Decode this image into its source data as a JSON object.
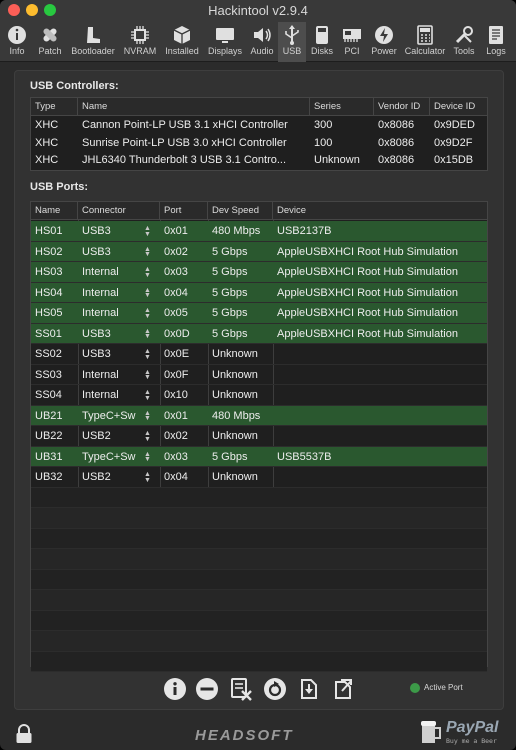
{
  "window": {
    "title": "Hackintool v2.9.4"
  },
  "toolbar": {
    "items": [
      {
        "label": "Info",
        "icon": "info-icon"
      },
      {
        "label": "Patch",
        "icon": "patch-icon"
      },
      {
        "label": "Bootloader",
        "icon": "boot-icon"
      },
      {
        "label": "NVRAM",
        "icon": "chip-icon"
      },
      {
        "label": "Installed",
        "icon": "package-icon"
      },
      {
        "label": "Displays",
        "icon": "display-icon"
      },
      {
        "label": "Audio",
        "icon": "speaker-icon"
      },
      {
        "label": "USB",
        "icon": "usb-icon"
      },
      {
        "label": "Disks",
        "icon": "disk-icon"
      },
      {
        "label": "PCI",
        "icon": "pci-icon"
      },
      {
        "label": "Power",
        "icon": "power-icon"
      },
      {
        "label": "Calculator",
        "icon": "calculator-icon"
      },
      {
        "label": "Tools",
        "icon": "tools-icon"
      },
      {
        "label": "Logs",
        "icon": "logs-icon"
      }
    ],
    "active": "USB"
  },
  "controllers": {
    "section_label": "USB Controllers:",
    "headers": {
      "type": "Type",
      "name": "Name",
      "series": "Series",
      "vendor": "Vendor ID",
      "device": "Device ID"
    },
    "rows": [
      {
        "type": "XHC",
        "name": "Cannon Point-LP USB 3.1 xHCI Controller",
        "series": "300",
        "vendor": "0x8086",
        "device": "0x9DED"
      },
      {
        "type": "XHC",
        "name": "Sunrise Point-LP USB 3.0 xHCI Controller",
        "series": "100",
        "vendor": "0x8086",
        "device": "0x9D2F"
      },
      {
        "type": "XHC",
        "name": "JHL6340 Thunderbolt 3 USB 3.1 Contro...",
        "series": "Unknown",
        "vendor": "0x8086",
        "device": "0x15DB"
      }
    ]
  },
  "ports": {
    "section_label": "USB Ports:",
    "headers": {
      "name": "Name",
      "connector": "Connector",
      "port": "Port",
      "speed": "Dev Speed",
      "device": "Device"
    },
    "rows": [
      {
        "name": "HS01",
        "connector": "USB3",
        "port": "0x01",
        "speed": "480 Mbps",
        "device": "USB2137B",
        "active": true
      },
      {
        "name": "HS02",
        "connector": "USB3",
        "port": "0x02",
        "speed": "5 Gbps",
        "device": "AppleUSBXHCI Root Hub Simulation",
        "active": true
      },
      {
        "name": "HS03",
        "connector": "Internal",
        "port": "0x03",
        "speed": "5 Gbps",
        "device": "AppleUSBXHCI Root Hub Simulation",
        "active": true
      },
      {
        "name": "HS04",
        "connector": "Internal",
        "port": "0x04",
        "speed": "5 Gbps",
        "device": "AppleUSBXHCI Root Hub Simulation",
        "active": true
      },
      {
        "name": "HS05",
        "connector": "Internal",
        "port": "0x05",
        "speed": "5 Gbps",
        "device": "AppleUSBXHCI Root Hub Simulation",
        "active": true
      },
      {
        "name": "SS01",
        "connector": "USB3",
        "port": "0x0D",
        "speed": "5 Gbps",
        "device": "AppleUSBXHCI Root Hub Simulation",
        "active": true
      },
      {
        "name": "SS02",
        "connector": "USB3",
        "port": "0x0E",
        "speed": "Unknown",
        "device": "",
        "active": false
      },
      {
        "name": "SS03",
        "connector": "Internal",
        "port": "0x0F",
        "speed": "Unknown",
        "device": "",
        "active": false
      },
      {
        "name": "SS04",
        "connector": "Internal",
        "port": "0x10",
        "speed": "Unknown",
        "device": "",
        "active": false
      },
      {
        "name": "UB21",
        "connector": "TypeC+Sw",
        "port": "0x01",
        "speed": "480 Mbps",
        "device": "",
        "active": true
      },
      {
        "name": "UB22",
        "connector": "USB2",
        "port": "0x02",
        "speed": "Unknown",
        "device": "",
        "active": false
      },
      {
        "name": "UB31",
        "connector": "TypeC+Sw",
        "port": "0x03",
        "speed": "5 Gbps",
        "device": "USB5537B",
        "active": true
      },
      {
        "name": "UB32",
        "connector": "USB2",
        "port": "0x04",
        "speed": "Unknown",
        "device": "",
        "active": false
      }
    ]
  },
  "bottom_bar": {
    "buttons": [
      "info-icon",
      "remove-icon",
      "clear-icon",
      "refresh-icon",
      "import-icon",
      "export-icon"
    ],
    "legend_label": "Active Port",
    "legend_color": "#3c9a48"
  },
  "footer": {
    "brand": "HEADSOFT",
    "paypal": "PayPal",
    "paypal_tagline": "Buy me a Beer"
  },
  "colors": {
    "active_row": "#2a582f",
    "background": "#2b2b2b"
  }
}
